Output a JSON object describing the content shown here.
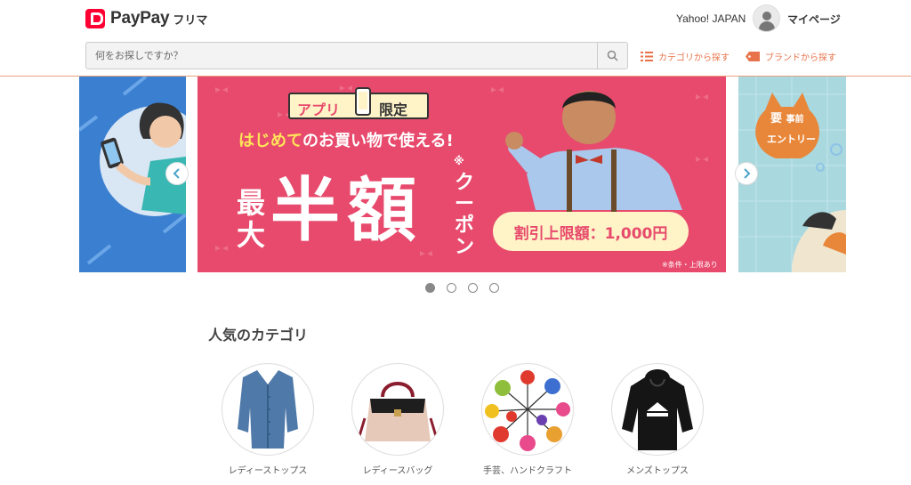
{
  "header": {
    "logo_text": "PayPay",
    "logo_sub": "フリマ",
    "yahoo_link": "Yahoo! JAPAN",
    "mypage_label": "マイページ"
  },
  "search": {
    "placeholder": "何をお探しですか？",
    "value": ""
  },
  "nav": {
    "category_label": "カテゴリから探す",
    "brand_label": "ブランドから探す"
  },
  "banner": {
    "tag_app": "アプリ",
    "tag_limited": "限定",
    "line1_highlight": "はじめて",
    "line1_rest": "のお買い物で使える!",
    "max": "最大",
    "half": "半額",
    "coupon": "クーポン",
    "mark": "※",
    "pill": "割引上限額：1,000円",
    "fine_print": "※条件・上限あり"
  },
  "right_slide": {
    "badge_line1": "要",
    "badge_line1b": "事前",
    "badge_line2": "エントリー"
  },
  "carousel": {
    "slide_count": 4,
    "active_index": 0
  },
  "categories": {
    "title": "人気のカテゴリ",
    "items": [
      {
        "label": "レディーストップス"
      },
      {
        "label": "レディースバッグ"
      },
      {
        "label": "手芸、ハンドクラフト"
      },
      {
        "label": "メンズトップス"
      }
    ]
  },
  "colors": {
    "accent": "#e8734a",
    "banner_pink": "#e74a6c",
    "brand_red": "#ff0033"
  }
}
